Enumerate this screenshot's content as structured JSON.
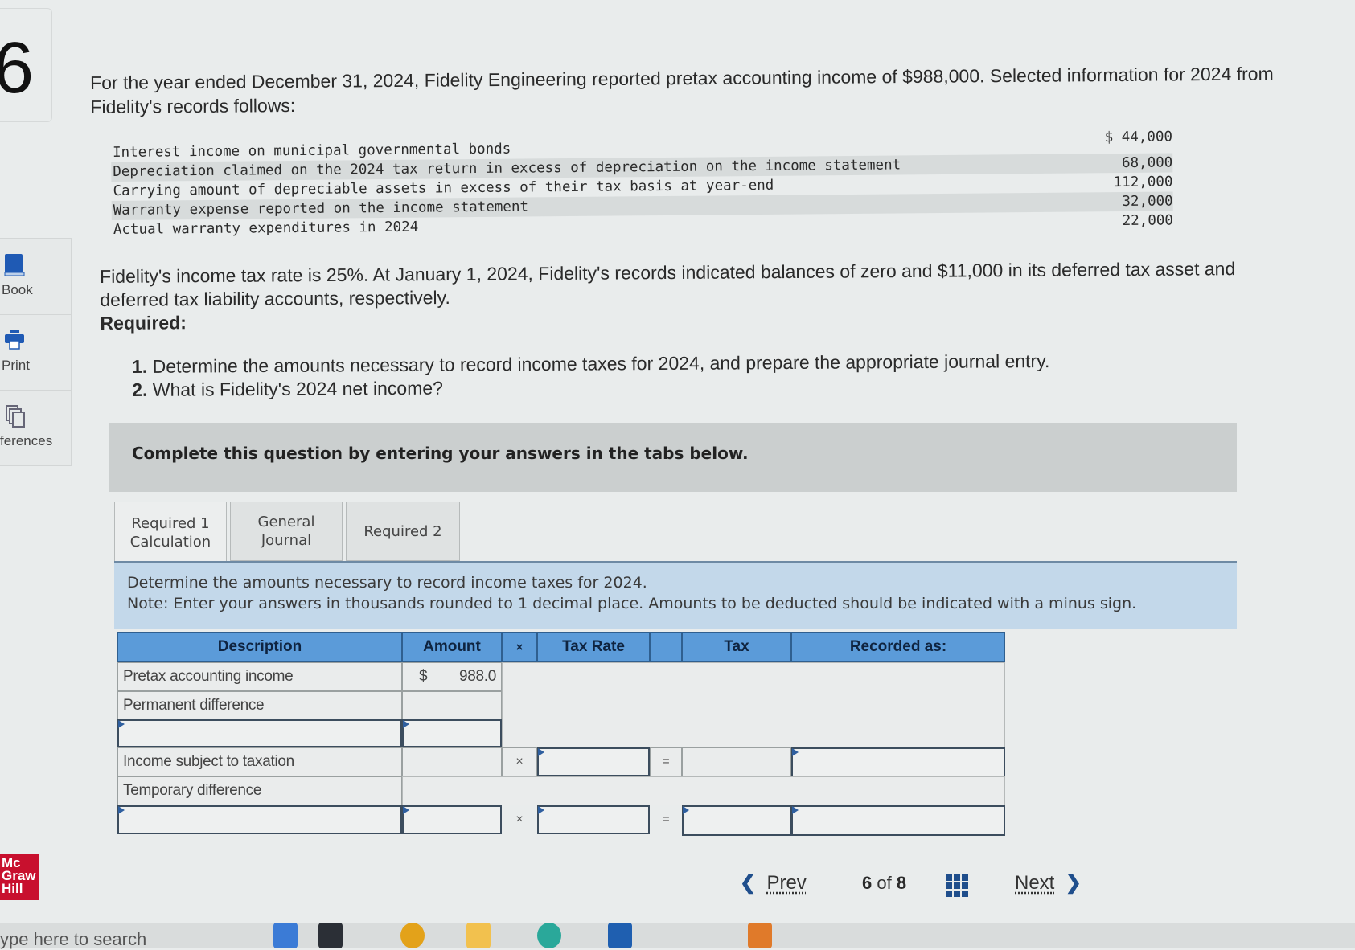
{
  "sidebar": {
    "question_number": "6",
    "items": [
      {
        "label": "Book",
        "icon": "book-icon"
      },
      {
        "label": "Print",
        "icon": "printer-icon"
      },
      {
        "label": "ferences",
        "icon": "references-icon"
      }
    ],
    "logo_lines": [
      "Mc",
      "Graw",
      "Hill"
    ]
  },
  "problem": {
    "intro": "For the year ended December 31, 2024, Fidelity Engineering reported pretax accounting income of $988,000. Selected information for 2024 from Fidelity's records follows:",
    "records": [
      {
        "description": "Interest income on municipal governmental bonds",
        "value": "$ 44,000"
      },
      {
        "description": "Depreciation claimed on the 2024 tax return in excess of depreciation on the income statement",
        "value": "68,000"
      },
      {
        "description": "Carrying amount of depreciable assets in excess of their tax basis at year-end",
        "value": "112,000"
      },
      {
        "description": "Warranty expense reported on the income statement",
        "value": "32,000"
      },
      {
        "description": "Actual warranty expenditures in 2024",
        "value": "22,000"
      }
    ],
    "paragraph2": "Fidelity's income tax rate is 25%. At January 1, 2024, Fidelity's records indicated balances of zero and $11,000 in its deferred tax asset and deferred tax liability accounts, respectively.",
    "required_label": "Required:",
    "requirements": [
      {
        "num": "1.",
        "text": "Determine the amounts necessary to record income taxes for 2024, and prepare the appropriate journal entry."
      },
      {
        "num": "2.",
        "text": "What is Fidelity's 2024 net income?"
      }
    ]
  },
  "banner": "Complete this question by entering your answers in the tabs below.",
  "tabs": [
    {
      "label_lines": [
        "Required 1",
        "Calculation"
      ],
      "active": true
    },
    {
      "label_lines": [
        "General",
        "Journal"
      ],
      "active": false
    },
    {
      "label_lines": [
        "Required 2"
      ],
      "active": false
    }
  ],
  "note": {
    "line1": "Determine the amounts necessary to record income taxes for 2024.",
    "line2": "Note: Enter your answers in thousands rounded to 1 decimal place. Amounts to be deducted should be indicated with a minus sign."
  },
  "table": {
    "headers": {
      "description": "Description",
      "amount": "Amount",
      "times": "×",
      "tax_rate": "Tax Rate",
      "blank": "",
      "tax": "Tax",
      "recorded_as": "Recorded as:"
    },
    "rows": {
      "pretax": {
        "label": "Pretax accounting income",
        "currency": "$",
        "amount": "988.0"
      },
      "permanent": {
        "label": "Permanent difference",
        "amount": ""
      },
      "blank_row": {
        "label": "",
        "amount": ""
      },
      "income_subject": {
        "label": "Income subject to taxation",
        "amount": "",
        "op1": "×",
        "tax_rate": "",
        "op2": "=",
        "tax": "",
        "recorded_as": ""
      },
      "temporary": {
        "label": "Temporary difference",
        "amount": ""
      },
      "temp_entry": {
        "label": "",
        "amount": "",
        "op1": "×",
        "tax_rate": "",
        "op2": "=",
        "tax": "",
        "recorded_as": ""
      }
    }
  },
  "footer": {
    "prev_label": "Prev",
    "page_current": "6",
    "page_of": "of",
    "page_total": "8",
    "next_label": "Next"
  },
  "taskbar": {
    "search_placeholder": "ype here to search"
  }
}
